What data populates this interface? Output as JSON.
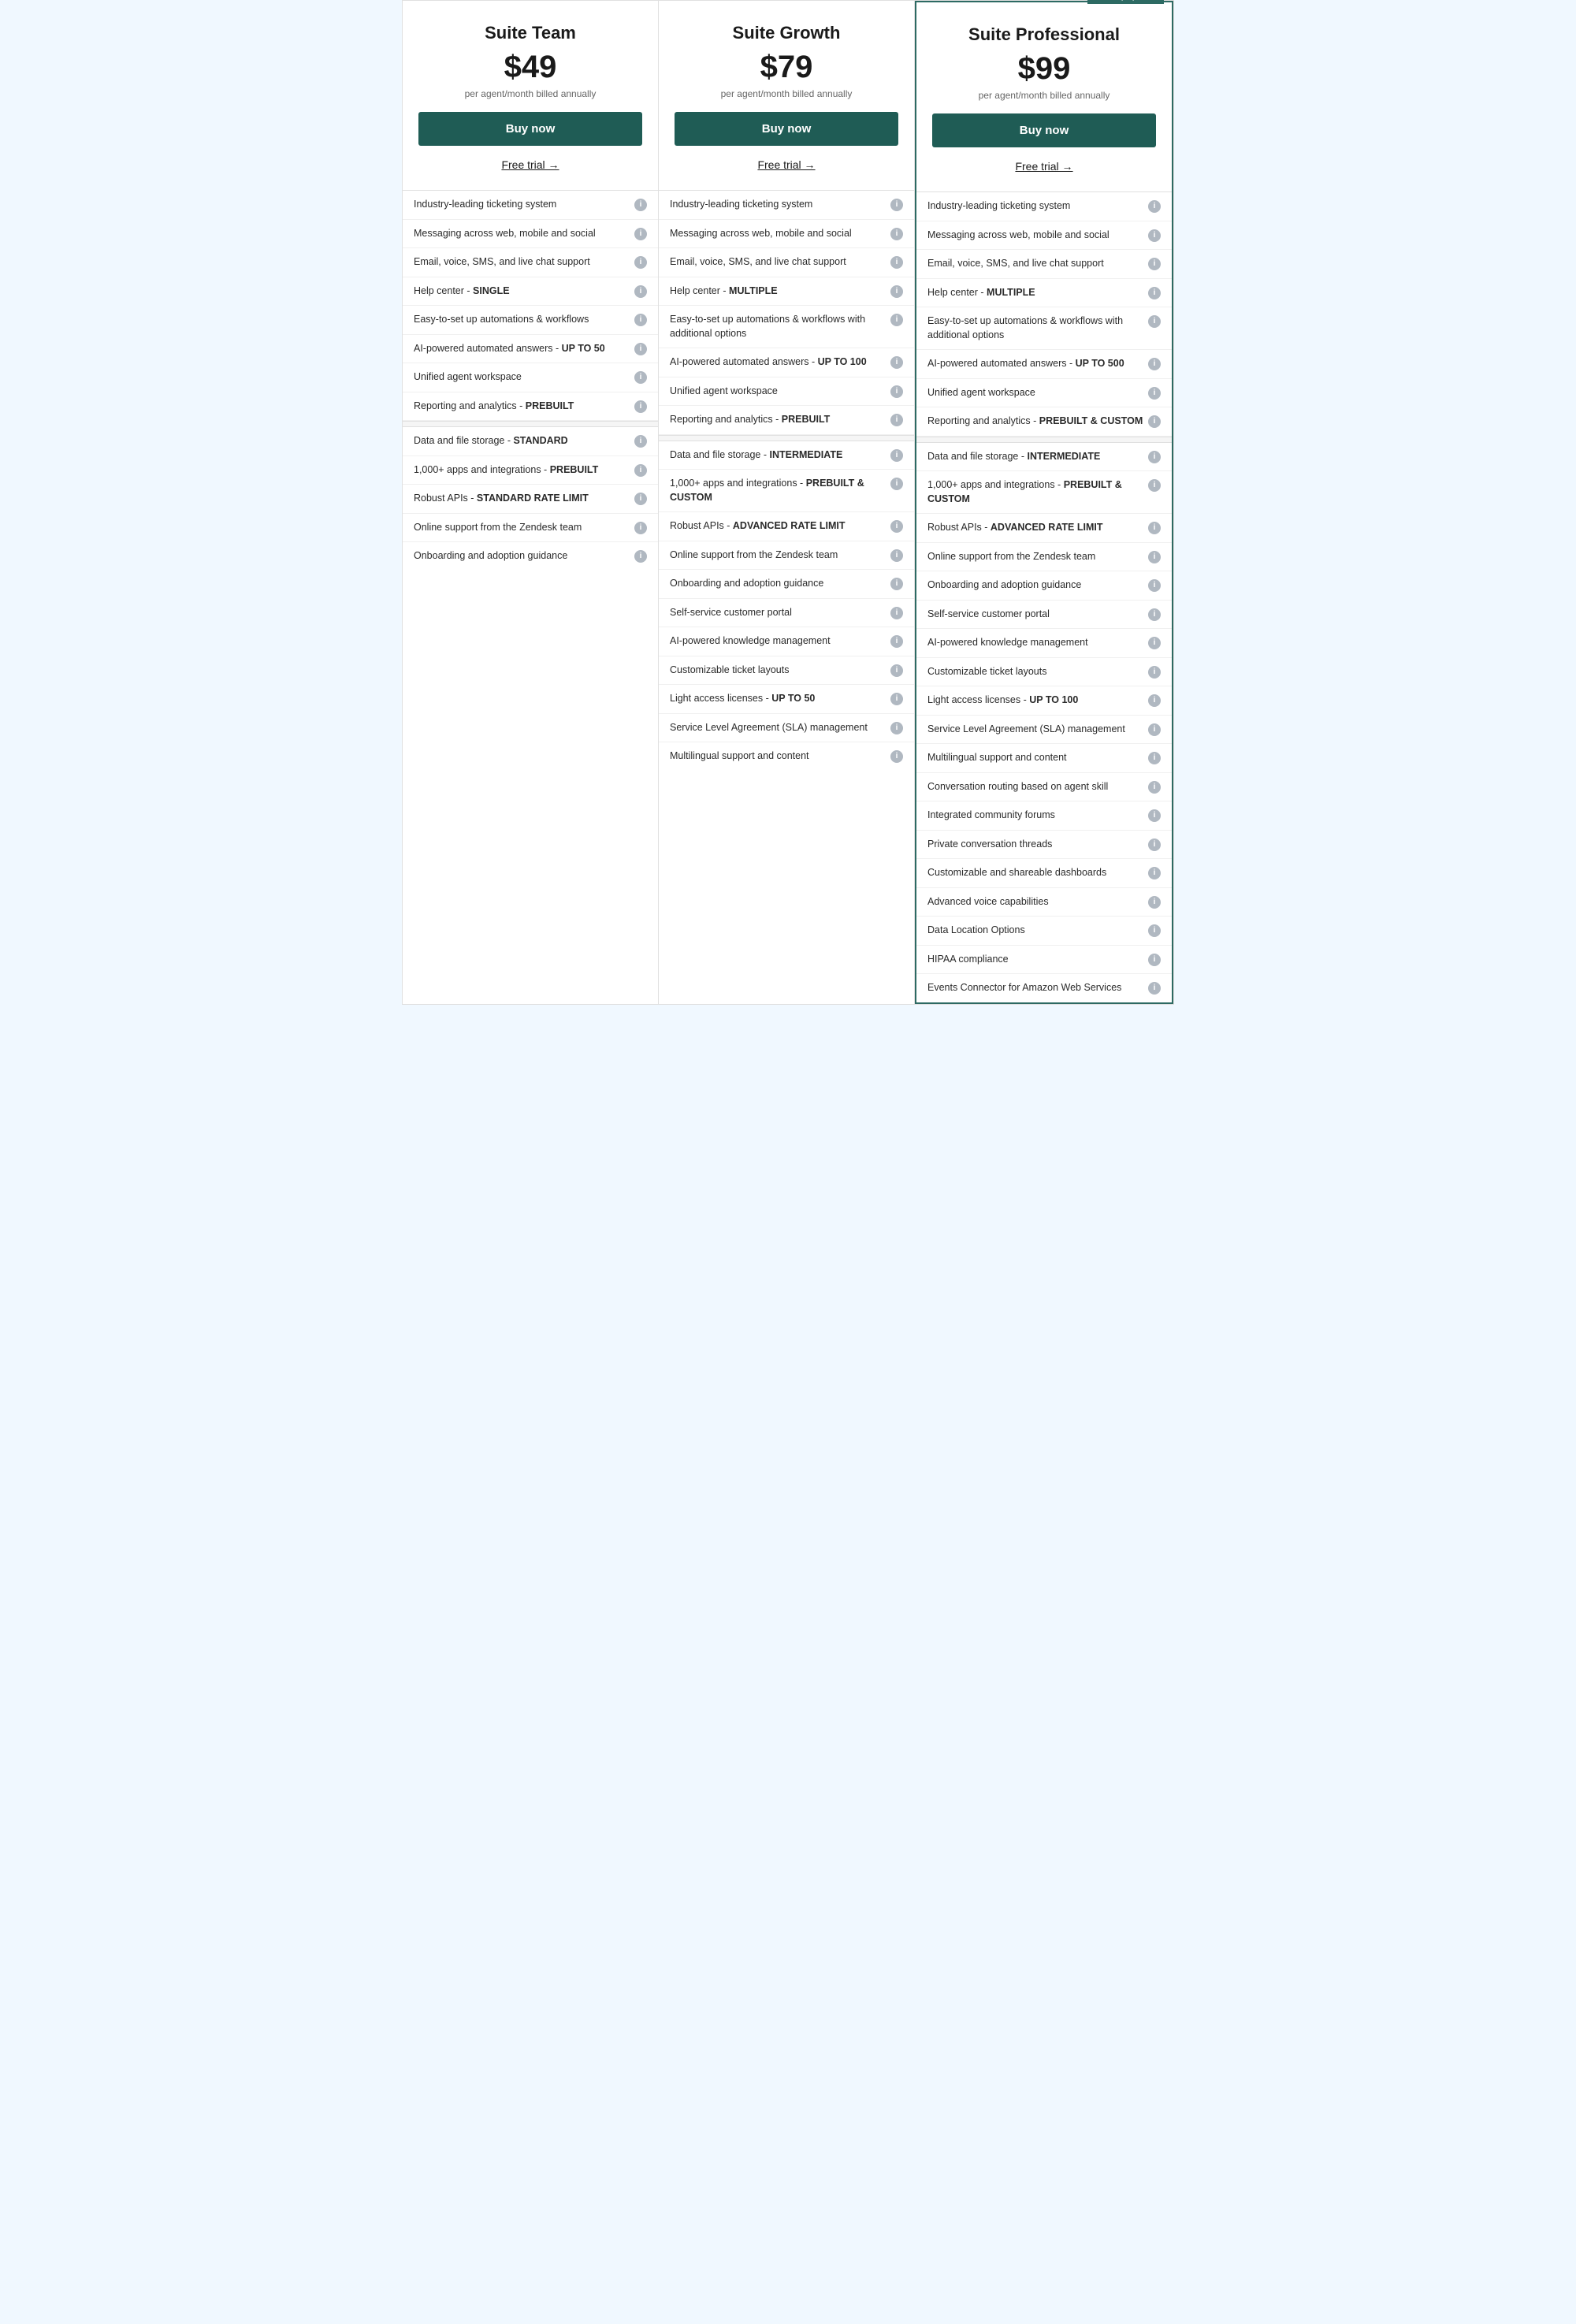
{
  "badge": {
    "label": "Most popular"
  },
  "plans": [
    {
      "id": "suite-team",
      "name": "Suite Team",
      "price": "$49",
      "billing": "per agent/month billed annually",
      "buy_label": "Buy now",
      "free_trial_label": "Free trial →",
      "featured": false,
      "features": [
        {
          "text": "Industry-leading ticketing system",
          "info": true
        },
        {
          "text": "Messaging across web, mobile and social",
          "info": true
        },
        {
          "text": "Email, voice, SMS, and live chat support",
          "info": true
        },
        {
          "text": "Help center - <strong>SINGLE</strong>",
          "info": true
        },
        {
          "text": "Easy-to-set up automations & workflows",
          "info": true
        },
        {
          "text": "AI-powered automated answers - <strong>UP TO 50</strong>",
          "info": true
        },
        {
          "text": "Unified agent workspace",
          "info": true
        },
        {
          "text": "Reporting and analytics - <strong>PREBUILT</strong>",
          "info": true,
          "divider_after": true
        },
        {
          "text": "Data and file storage - <strong>STANDARD</strong>",
          "info": true
        },
        {
          "text": "1,000+ apps and integrations - <strong>PREBUILT</strong>",
          "info": true
        },
        {
          "text": "Robust APIs - <strong>STANDARD RATE LIMIT</strong>",
          "info": true
        },
        {
          "text": "Online support from the Zendesk team",
          "info": true
        },
        {
          "text": "Onboarding and adoption guidance",
          "info": true
        }
      ]
    },
    {
      "id": "suite-growth",
      "name": "Suite Growth",
      "price": "$79",
      "billing": "per agent/month billed annually",
      "buy_label": "Buy now",
      "free_trial_label": "Free trial →",
      "featured": false,
      "features": [
        {
          "text": "Industry-leading ticketing system",
          "info": true
        },
        {
          "text": "Messaging across web, mobile and social",
          "info": true
        },
        {
          "text": "Email, voice, SMS, and live chat support",
          "info": true
        },
        {
          "text": "Help center - <strong>MULTIPLE</strong>",
          "info": true
        },
        {
          "text": "Easy-to-set up automations & workflows with additional options",
          "info": true
        },
        {
          "text": "AI-powered automated answers - <strong>UP TO 100</strong>",
          "info": true
        },
        {
          "text": "Unified agent workspace",
          "info": true
        },
        {
          "text": "Reporting and analytics - <strong>PREBUILT</strong>",
          "info": true,
          "divider_after": true
        },
        {
          "text": "Data and file storage - <strong>INTERMEDIATE</strong>",
          "info": true
        },
        {
          "text": "1,000+ apps and integrations - <strong>PREBUILT & CUSTOM</strong>",
          "info": true
        },
        {
          "text": "Robust APIs - <strong>ADVANCED RATE LIMIT</strong>",
          "info": true
        },
        {
          "text": "Online support from the Zendesk team",
          "info": true
        },
        {
          "text": "Onboarding and adoption guidance",
          "info": true
        },
        {
          "text": "Self-service customer portal",
          "info": true
        },
        {
          "text": "AI-powered knowledge management",
          "info": true
        },
        {
          "text": "Customizable ticket layouts",
          "info": true
        },
        {
          "text": "Light access licenses - <strong>UP TO 50</strong>",
          "info": true
        },
        {
          "text": "Service Level Agreement (SLA) management",
          "info": true
        },
        {
          "text": "Multilingual support and content",
          "info": true
        }
      ]
    },
    {
      "id": "suite-professional",
      "name": "Suite Professional",
      "price": "$99",
      "billing": "per agent/month billed annually",
      "buy_label": "Buy now",
      "free_trial_label": "Free trial →",
      "featured": true,
      "features": [
        {
          "text": "Industry-leading ticketing system",
          "info": true
        },
        {
          "text": "Messaging across web, mobile and social",
          "info": true
        },
        {
          "text": "Email, voice, SMS, and live chat support",
          "info": true
        },
        {
          "text": "Help center - <strong>MULTIPLE</strong>",
          "info": true
        },
        {
          "text": "Easy-to-set up automations & workflows with additional options",
          "info": true
        },
        {
          "text": "AI-powered automated answers - <strong>UP TO 500</strong>",
          "info": true
        },
        {
          "text": "Unified agent workspace",
          "info": true
        },
        {
          "text": "Reporting and analytics - <strong>PREBUILT & CUSTOM</strong>",
          "info": true,
          "divider_after": true
        },
        {
          "text": "Data and file storage - <strong>INTERMEDIATE</strong>",
          "info": true
        },
        {
          "text": "1,000+ apps and integrations - <strong>PREBUILT & CUSTOM</strong>",
          "info": true
        },
        {
          "text": "Robust APIs - <strong>ADVANCED RATE LIMIT</strong>",
          "info": true
        },
        {
          "text": "Online support from the Zendesk team",
          "info": true
        },
        {
          "text": "Onboarding and adoption guidance",
          "info": true
        },
        {
          "text": "Self-service customer portal",
          "info": true
        },
        {
          "text": "AI-powered knowledge management",
          "info": true
        },
        {
          "text": "Customizable ticket layouts",
          "info": true
        },
        {
          "text": "Light access licenses - <strong>UP TO 100</strong>",
          "info": true
        },
        {
          "text": "Service Level Agreement (SLA) management",
          "info": true
        },
        {
          "text": "Multilingual support and content",
          "info": true
        },
        {
          "text": "Conversation routing based on agent skill",
          "info": true
        },
        {
          "text": "Integrated community forums",
          "info": true
        },
        {
          "text": "Private conversation threads",
          "info": true
        },
        {
          "text": "Customizable and shareable dashboards",
          "info": true
        },
        {
          "text": "Advanced voice capabilities",
          "info": true
        },
        {
          "text": "Data Location Options",
          "info": true
        },
        {
          "text": "HIPAA compliance",
          "info": true
        },
        {
          "text": "Events Connector for Amazon Web Services",
          "info": true
        }
      ]
    }
  ]
}
